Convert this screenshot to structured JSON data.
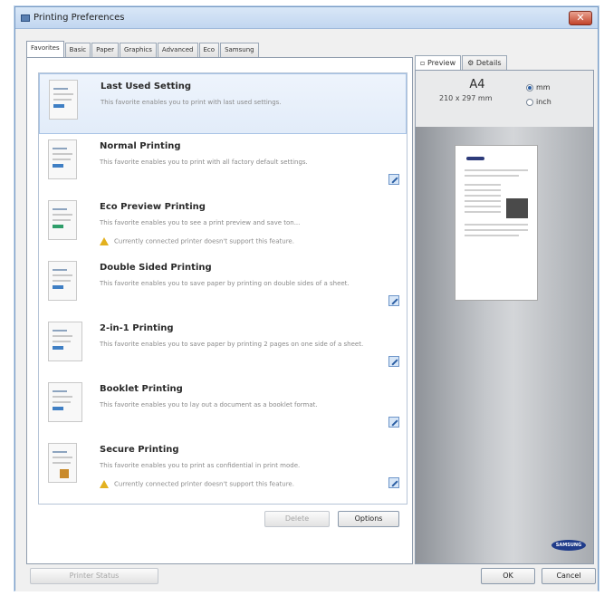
{
  "window": {
    "title": "Printing Preferences",
    "close_label": "✕"
  },
  "tabs": [
    "Favorites",
    "Basic",
    "Paper",
    "Graphics",
    "Advanced",
    "Eco",
    "Samsung"
  ],
  "favorites": [
    {
      "title": "Last Used Setting",
      "desc": "This favorite enables you to print with last used settings.",
      "warning": "",
      "editable": false
    },
    {
      "title": "Normal Printing",
      "desc": "This favorite enables you to print with all factory default settings.",
      "warning": "",
      "editable": true
    },
    {
      "title": "Eco Preview Printing",
      "desc": "This favorite enables you to see a print preview and save ton...",
      "warning": "Currently connected printer doesn't support this feature.",
      "editable": false
    },
    {
      "title": "Double Sided Printing",
      "desc": "This favorite enables you to save paper by printing on double sides of a sheet.",
      "warning": "",
      "editable": true
    },
    {
      "title": "2-in-1 Printing",
      "desc": "This favorite enables you to save paper by printing 2 pages on one side of a sheet.",
      "warning": "",
      "editable": true
    },
    {
      "title": "Booklet Printing",
      "desc": "This favorite enables you to lay out a document as a booklet format.",
      "warning": "",
      "editable": true
    },
    {
      "title": "Secure Printing",
      "desc": "This favorite enables you to print as confidential in print mode.",
      "warning": "Currently connected printer doesn't support this feature.",
      "editable": true
    }
  ],
  "buttons": {
    "delete": "Delete",
    "options": "Options",
    "printer_status": "Printer Status",
    "ok": "OK",
    "cancel": "Cancel"
  },
  "side": {
    "tabs": [
      "Preview",
      "Details"
    ],
    "paper_name": "A4",
    "paper_dims": "210 x 297 mm",
    "unit_mm": "mm",
    "unit_inch": "inch",
    "selected_unit": "mm",
    "brand": "SAMSUNG"
  },
  "colors": {
    "accent": "#2b5ea3",
    "close": "#c2432a",
    "warning": "#e3b11f"
  }
}
